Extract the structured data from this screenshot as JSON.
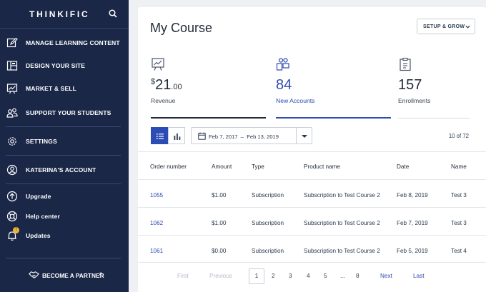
{
  "brand": {
    "name": "THINKIFIC"
  },
  "sidebar": {
    "items": [
      {
        "label": "MANAGE LEARNING CONTENT"
      },
      {
        "label": "DESIGN YOUR SITE"
      },
      {
        "label": "MARKET & SELL"
      },
      {
        "label": "SUPPORT YOUR STUDENTS"
      },
      {
        "label": "SETTINGS"
      },
      {
        "label": "KATERINA'S ACCOUNT"
      },
      {
        "label": "Upgrade"
      },
      {
        "label": "Help center"
      },
      {
        "label": "Updates"
      }
    ],
    "updates_badge": "!",
    "partner_label": "BECOME A PARTNER",
    "partner_arrow": "↗"
  },
  "main": {
    "title": "My Course",
    "setup_button": "SETUP & GROW",
    "stats": [
      {
        "currency": "$",
        "whole": "21",
        "cents": ".00",
        "caption": "Revenue"
      },
      {
        "value": "84",
        "caption": "New Accounts"
      },
      {
        "value": "157",
        "caption": "Enrollments"
      }
    ],
    "date_from": "Feb 7, 2017",
    "date_sep": "–",
    "date_to": "Feb 13, 2019",
    "count": "10 of 72",
    "table": {
      "headers": [
        "Order number",
        "Amount",
        "Type",
        "Product name",
        "Date",
        "Name"
      ],
      "rows": [
        [
          "1055",
          "$1.00",
          "Subscription",
          "Subscription to Test Course 2",
          "Feb 8, 2019",
          "Test 3"
        ],
        [
          "1062",
          "$1.00",
          "Subscription",
          "Subscription to Test Course 2",
          "Feb 7, 2019",
          "Test 3"
        ],
        [
          "1061",
          "$0.00",
          "Subscription",
          "Subscription to Test Course 2",
          "Feb 5, 2019",
          "Test 4"
        ]
      ]
    },
    "pager": {
      "first": "First",
      "previous": "Previous",
      "pages": [
        "1",
        "2",
        "3",
        "4",
        "5",
        "...",
        "8"
      ],
      "next": "Next",
      "last": "Last"
    }
  },
  "colors": {
    "sidebar": "#1a2747",
    "accent": "#2d4bb0",
    "badge": "#f2b53a"
  }
}
